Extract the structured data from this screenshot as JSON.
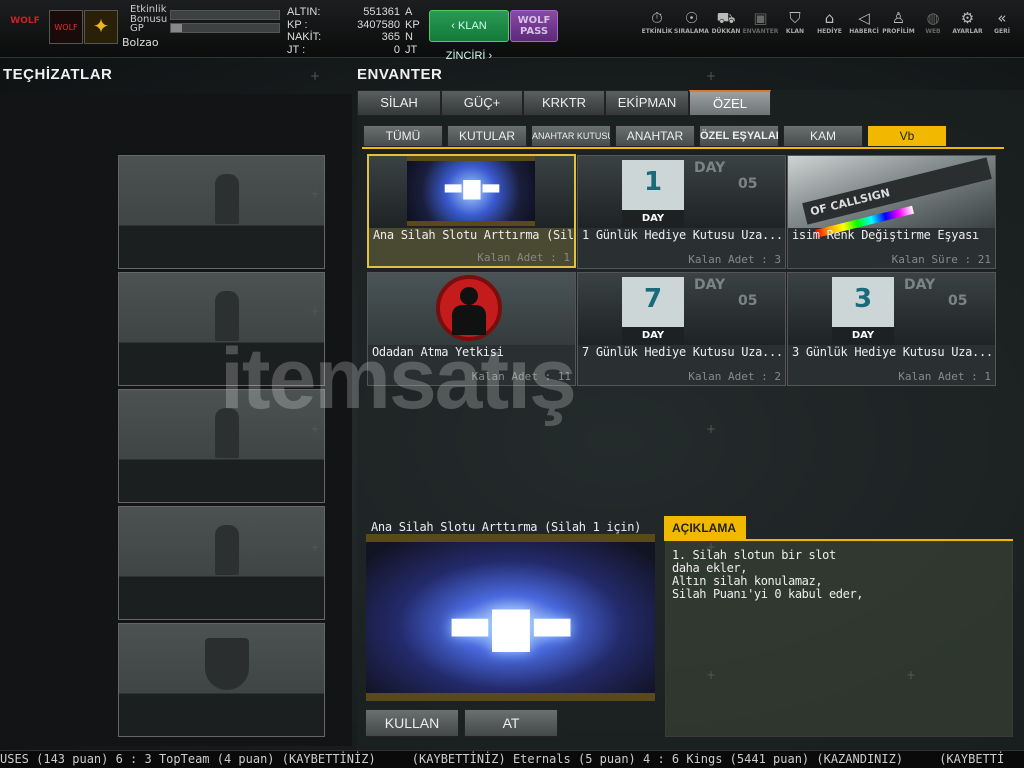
{
  "header": {
    "logo1": "WOLF",
    "logo2": "WOLF",
    "etkinlik_label": "Etkinlik\nBonusu",
    "gp_label": "GP",
    "gp_progress": 0.1,
    "etkinlik_progress": 0.0,
    "username": "Bolzao",
    "stats": [
      {
        "label": "ALTIN:",
        "value": "551361",
        "unit": "A"
      },
      {
        "label": "KP :",
        "value": "3407580",
        "unit": "KP"
      },
      {
        "label": "NAKİT:",
        "value": "365",
        "unit": "N"
      },
      {
        "label": "JT :",
        "value": "0",
        "unit": "JT"
      }
    ],
    "klan_zinciri": "KLAN ZİNCİRİ",
    "wolf_pass": "WOLF\nPASS",
    "nav": [
      {
        "label": "ETKİNLİK",
        "icon": "timer-icon",
        "glyph": "⏱",
        "enabled": true
      },
      {
        "label": "SIRALAMA",
        "icon": "medal-icon",
        "glyph": "☉",
        "enabled": true
      },
      {
        "label": "DÜKKAN",
        "icon": "cart-icon",
        "glyph": "⛟",
        "enabled": true
      },
      {
        "label": "ENVANTER",
        "icon": "inventory-icon",
        "glyph": "▣",
        "enabled": false
      },
      {
        "label": "KLAN",
        "icon": "shield-icon",
        "glyph": "⛉",
        "enabled": true
      },
      {
        "label": "HEDİYE",
        "icon": "gift-icon",
        "glyph": "⌂",
        "enabled": true
      },
      {
        "label": "HABERCİ",
        "icon": "megaphone-icon",
        "glyph": "◁",
        "enabled": true
      },
      {
        "label": "PROFİLİM",
        "icon": "profile-icon",
        "glyph": "♙",
        "enabled": true
      },
      {
        "label": "WEB",
        "icon": "globe-icon",
        "glyph": "◍",
        "enabled": false
      },
      {
        "label": "AYARLAR",
        "icon": "gear-icon",
        "glyph": "⚙",
        "enabled": true
      },
      {
        "label": "GERİ",
        "icon": "back-icon",
        "glyph": "«",
        "enabled": true
      }
    ]
  },
  "left": {
    "title": "TEÇHİZATLAR"
  },
  "inventory": {
    "title": "ENVANTER",
    "tabs": [
      "SİLAH",
      "GÜÇ+",
      "KRKTR",
      "EKİPMAN",
      "ÖZEL"
    ],
    "active_tab": "ÖZEL",
    "subtabs": [
      "TÜMÜ",
      "KUTULAR",
      "ANAHTAR KUTUSU",
      "ANAHTAR",
      "ÖZEL EŞYALAR",
      "KAM",
      "Vb"
    ],
    "active_subtab": "Vb",
    "items": [
      {
        "name": "Ana Silah Slotu Arttırma (Sil...",
        "count": "Kalan Adet : 1",
        "kind": "gun"
      },
      {
        "name": "1 Günlük Hediye Kutusu Uza...",
        "count": "Kalan Adet : 3",
        "kind": "day",
        "day": "1"
      },
      {
        "name": "isim Renk Değiştirme Eşyası",
        "count": "Kalan Süre : 21",
        "kind": "callsign",
        "img_text": "OF CALLSIGN"
      },
      {
        "name": "Odadan Atma Yetkisi",
        "count": "Kalan Adet : 11",
        "kind": "kick"
      },
      {
        "name": "7 Günlük Hediye Kutusu Uza...",
        "count": "Kalan Adet : 2",
        "kind": "day",
        "day": "7"
      },
      {
        "name": "3 Günlük Hediye Kutusu Uza...",
        "count": "Kalan Adet : 1",
        "kind": "day",
        "day": "3"
      }
    ],
    "day_word": "DAY",
    "ghost_05": "05",
    "detail_title": "Ana Silah Slotu Arttırma (Silah 1 için)",
    "buttons": {
      "use": "KULLAN",
      "drop": "AT"
    },
    "description_header": "AÇIKLAMA",
    "description_lines": [
      "1. Silah slotun bir slot",
      "daha ekler,",
      "Altın silah konulamaz,",
      "Silah Puanı'yi 0 kabul eder,"
    ]
  },
  "watermark": "itemsatış",
  "ticker": "USES (143 puan) 6 : 3 TopTeam (4 puan) (KAYBETTİNİZ)     (KAYBETTİNİZ) Eternals (5 puan) 4 : 6 Kings (5441 puan) (KAZANDINIZ)     (KAYBETTİ"
}
